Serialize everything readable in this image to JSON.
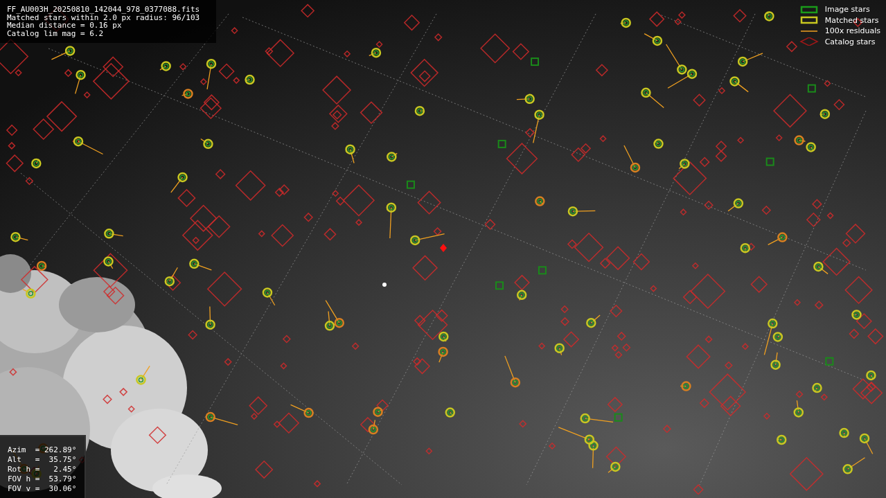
{
  "info_box": {
    "lines": [
      "FF_AU003H_20250810_142044_978_0377088.fits",
      "Matched stars within 2.0 px radius: 96/103",
      "Median distance = 0.16 px",
      "Catalog lim mag = 6.2"
    ]
  },
  "legend": {
    "items": [
      {
        "label": "Image stars"
      },
      {
        "kind": "matched",
        "label": "Matched stars"
      },
      {
        "kind": "residual",
        "label": "100x residuals"
      },
      {
        "kind": "catalog",
        "label": "Catalog stars"
      }
    ]
  },
  "pointing": {
    "lines": [
      "Azim  = 262.89°",
      "Alt   =  35.75°",
      "Rot h =   2.45°",
      "FOV h =  53.79°",
      "FOV v =  30.06°"
    ]
  }
}
